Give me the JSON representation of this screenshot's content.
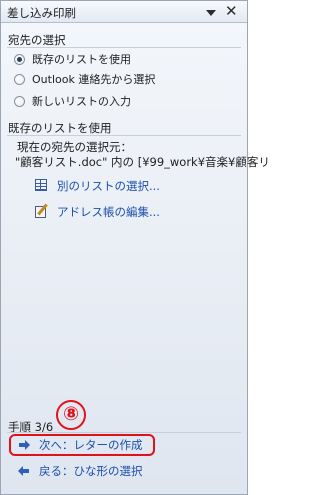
{
  "pane": {
    "title": "差し込み印刷",
    "dropdown_icon": "chevron-down-icon",
    "close_icon": "close-icon"
  },
  "recipients_section": {
    "heading": "宛先の選択",
    "options": [
      {
        "label": "既存のリストを使用",
        "checked": true
      },
      {
        "label": "Outlook 連絡先から選択",
        "checked": false
      },
      {
        "label": "新しいリストの入力",
        "checked": false
      }
    ]
  },
  "existing_list_section": {
    "heading": "既存のリストを使用",
    "current_source_label": "現在の宛先の選択元：",
    "current_source_value": "\"顧客リスト.doc\" 内の [¥99_work¥音楽¥顧客リ",
    "links": [
      {
        "label": "別のリストの選択...",
        "icon": "table-icon"
      },
      {
        "label": "アドレス帳の編集...",
        "icon": "edit-list-icon"
      }
    ]
  },
  "steps": {
    "label": "手順 3/6",
    "annotation_number": "⑧",
    "annotation_color": "#e1121a",
    "next": "次へ：レターの作成",
    "back": "戻る：ひな形の選択"
  }
}
